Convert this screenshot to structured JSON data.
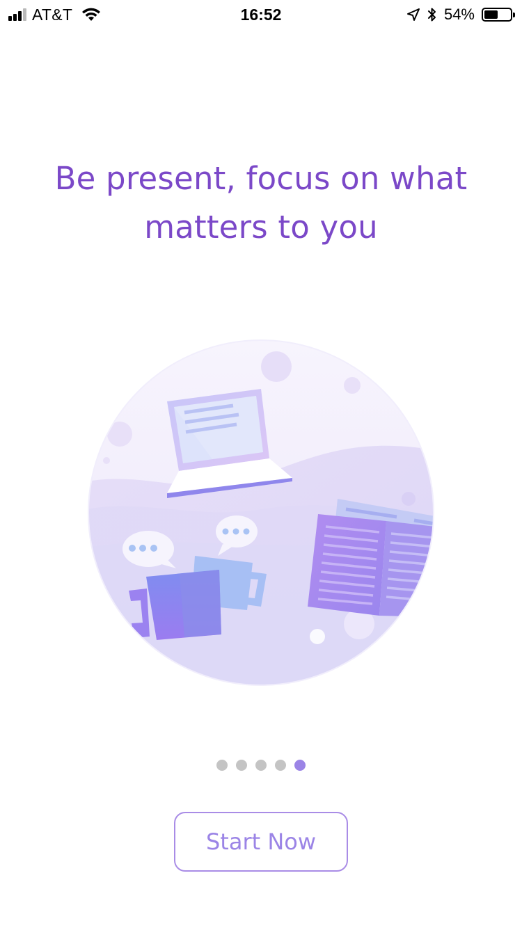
{
  "status_bar": {
    "carrier": "AT&T",
    "time": "16:52",
    "battery_percent_text": "54%",
    "battery_level": 0.54,
    "signal_bars_active": 3,
    "signal_bars_total": 4,
    "icons": [
      "signal-icon",
      "wifi-icon",
      "location-arrow-icon",
      "bluetooth-icon",
      "battery-icon"
    ]
  },
  "onboarding": {
    "headline_line1": "Be present, focus on what",
    "headline_line2": "matters to you",
    "illustration_icons": [
      "laptop-icon",
      "chat-bubble-icon",
      "mug-icon",
      "open-book-icon"
    ],
    "page_count": 5,
    "active_page": 5,
    "start_button_label": "Start Now"
  },
  "colors": {
    "headline": "#7b48c8",
    "accent": "#9b84e6",
    "button_border": "#a98ce6",
    "dot_inactive": "#c4c4c4",
    "dot_active": "#9b84e6"
  }
}
